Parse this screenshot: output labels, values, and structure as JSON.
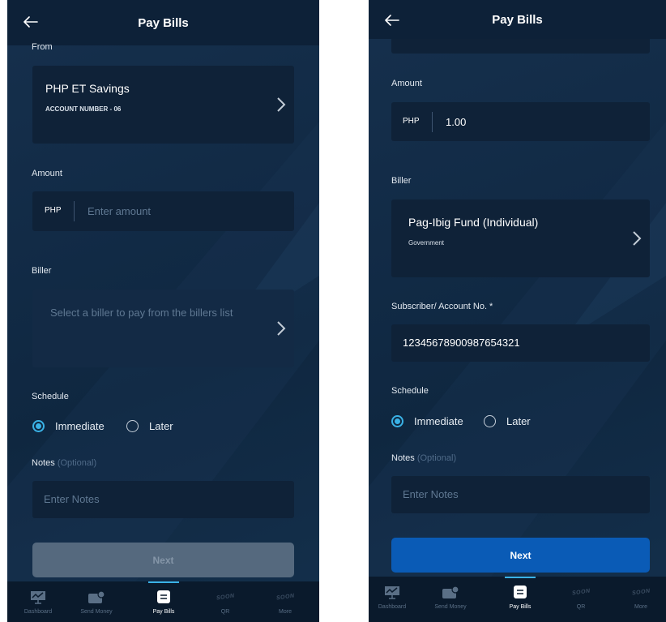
{
  "header": {
    "title": "Pay Bills"
  },
  "screen1": {
    "from_label": "From",
    "account": {
      "name": "PHP ET Savings",
      "number": "ACCOUNT NUMBER - 06"
    },
    "amount_label": "Amount",
    "currency": "PHP",
    "amount_placeholder": "Enter amount",
    "biller_label": "Biller",
    "biller_placeholder": "Select a biller to pay from the billers list",
    "schedule_label": "Schedule",
    "schedule_immediate": "Immediate",
    "schedule_later": "Later",
    "notes_label": "Notes",
    "notes_optional": "(Optional)",
    "notes_placeholder": "Enter Notes",
    "next_label": "Next"
  },
  "screen2": {
    "amount_label": "Amount",
    "currency": "PHP",
    "amount_value": "1.00",
    "biller_label": "Biller",
    "biller": {
      "name": "Pag-Ibig Fund (Individual)",
      "category": "Government"
    },
    "subscriber_label": "Subscriber/ Account No. *",
    "subscriber_value": "12345678900987654321",
    "schedule_label": "Schedule",
    "schedule_immediate": "Immediate",
    "schedule_later": "Later",
    "notes_label": "Notes",
    "notes_optional": "(Optional)",
    "notes_placeholder": "Enter Notes",
    "next_label": "Next"
  },
  "nav": {
    "items": [
      {
        "label": "Dashboard",
        "icon": "dashboard-icon"
      },
      {
        "label": "Send Money",
        "icon": "send-money-icon"
      },
      {
        "label": "Pay Bills",
        "icon": "pay-bills-icon",
        "active": true
      },
      {
        "label": "QR",
        "icon": "qr-icon",
        "badge": "SOON"
      },
      {
        "label": "More",
        "icon": "more-icon",
        "badge": "SOON"
      }
    ]
  },
  "colors": {
    "accent": "#3ab2e6",
    "primary_button": "#0a5bb6",
    "header": "#0d2138",
    "card": "#0f2238"
  }
}
